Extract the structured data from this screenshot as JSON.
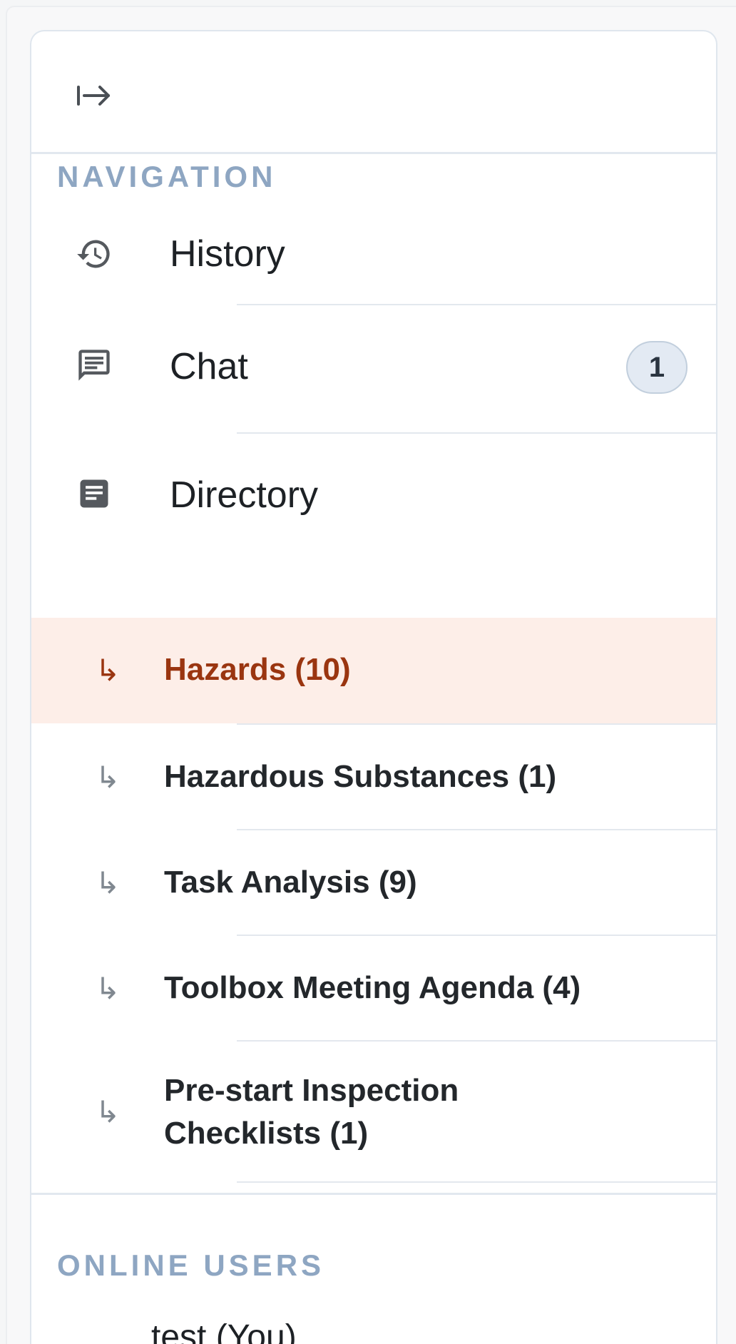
{
  "sidebar": {
    "toggle_icon": "expand-right-icon",
    "nav_section_label": "NAVIGATION",
    "nav_items": [
      {
        "label": "History",
        "icon": "history-icon"
      },
      {
        "label": "Chat",
        "icon": "chat-icon",
        "badge": "1"
      },
      {
        "label": "Directory",
        "icon": "document-icon"
      }
    ],
    "sub_items": [
      {
        "label": "Hazards (10)",
        "active": true
      },
      {
        "label": "Hazardous Substances (1)"
      },
      {
        "label": "Task Analysis (9)"
      },
      {
        "label": "Toolbox Meeting Agenda (4)"
      },
      {
        "label_line1": "Pre-start Inspection",
        "label_line2": "Checklists (1)"
      }
    ],
    "users_section_label": "ONLINE USERS",
    "online_users": [
      {
        "name": "test (You)"
      }
    ]
  },
  "colors": {
    "accent": "#9a3510",
    "active_bg": "#fdeee8",
    "section_label": "#8ea6c2",
    "badge_bg": "#e3eaf3"
  }
}
